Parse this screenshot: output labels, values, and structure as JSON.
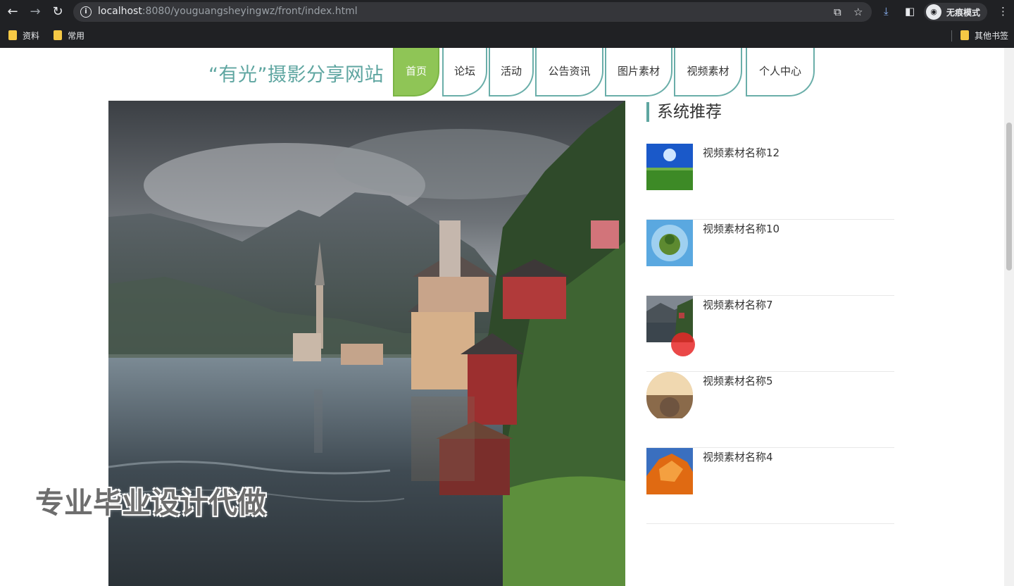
{
  "browser": {
    "url_host": "localhost",
    "url_rest": ":8080/youguangsheyingwz/front/index.html",
    "incognito_label": "无痕模式",
    "bookmarks": [
      "资料",
      "常用"
    ],
    "other_bookmarks": "其他书签"
  },
  "site": {
    "title": "“有光”摄影分享网站",
    "nav": [
      "首页",
      "论坛",
      "活动",
      "公告资讯",
      "图片素材",
      "视频素材",
      "个人中心"
    ],
    "active_nav": "首页"
  },
  "recommend": {
    "heading": "系统推荐",
    "items": [
      {
        "name": "视频素材名称12",
        "thumb": "grass-sky"
      },
      {
        "name": "视频素材名称10",
        "thumb": "tiny-planet"
      },
      {
        "name": "视频素材名称7",
        "thumb": "lake-town"
      },
      {
        "name": "视频素材名称5",
        "thumb": "sunset-globe"
      },
      {
        "name": "视频素材名称4",
        "thumb": "orange-rock"
      }
    ]
  },
  "watermark": "专业毕业设计代做",
  "colors": {
    "accent": "#5fa6a1",
    "active_tab": "#8fc556"
  }
}
